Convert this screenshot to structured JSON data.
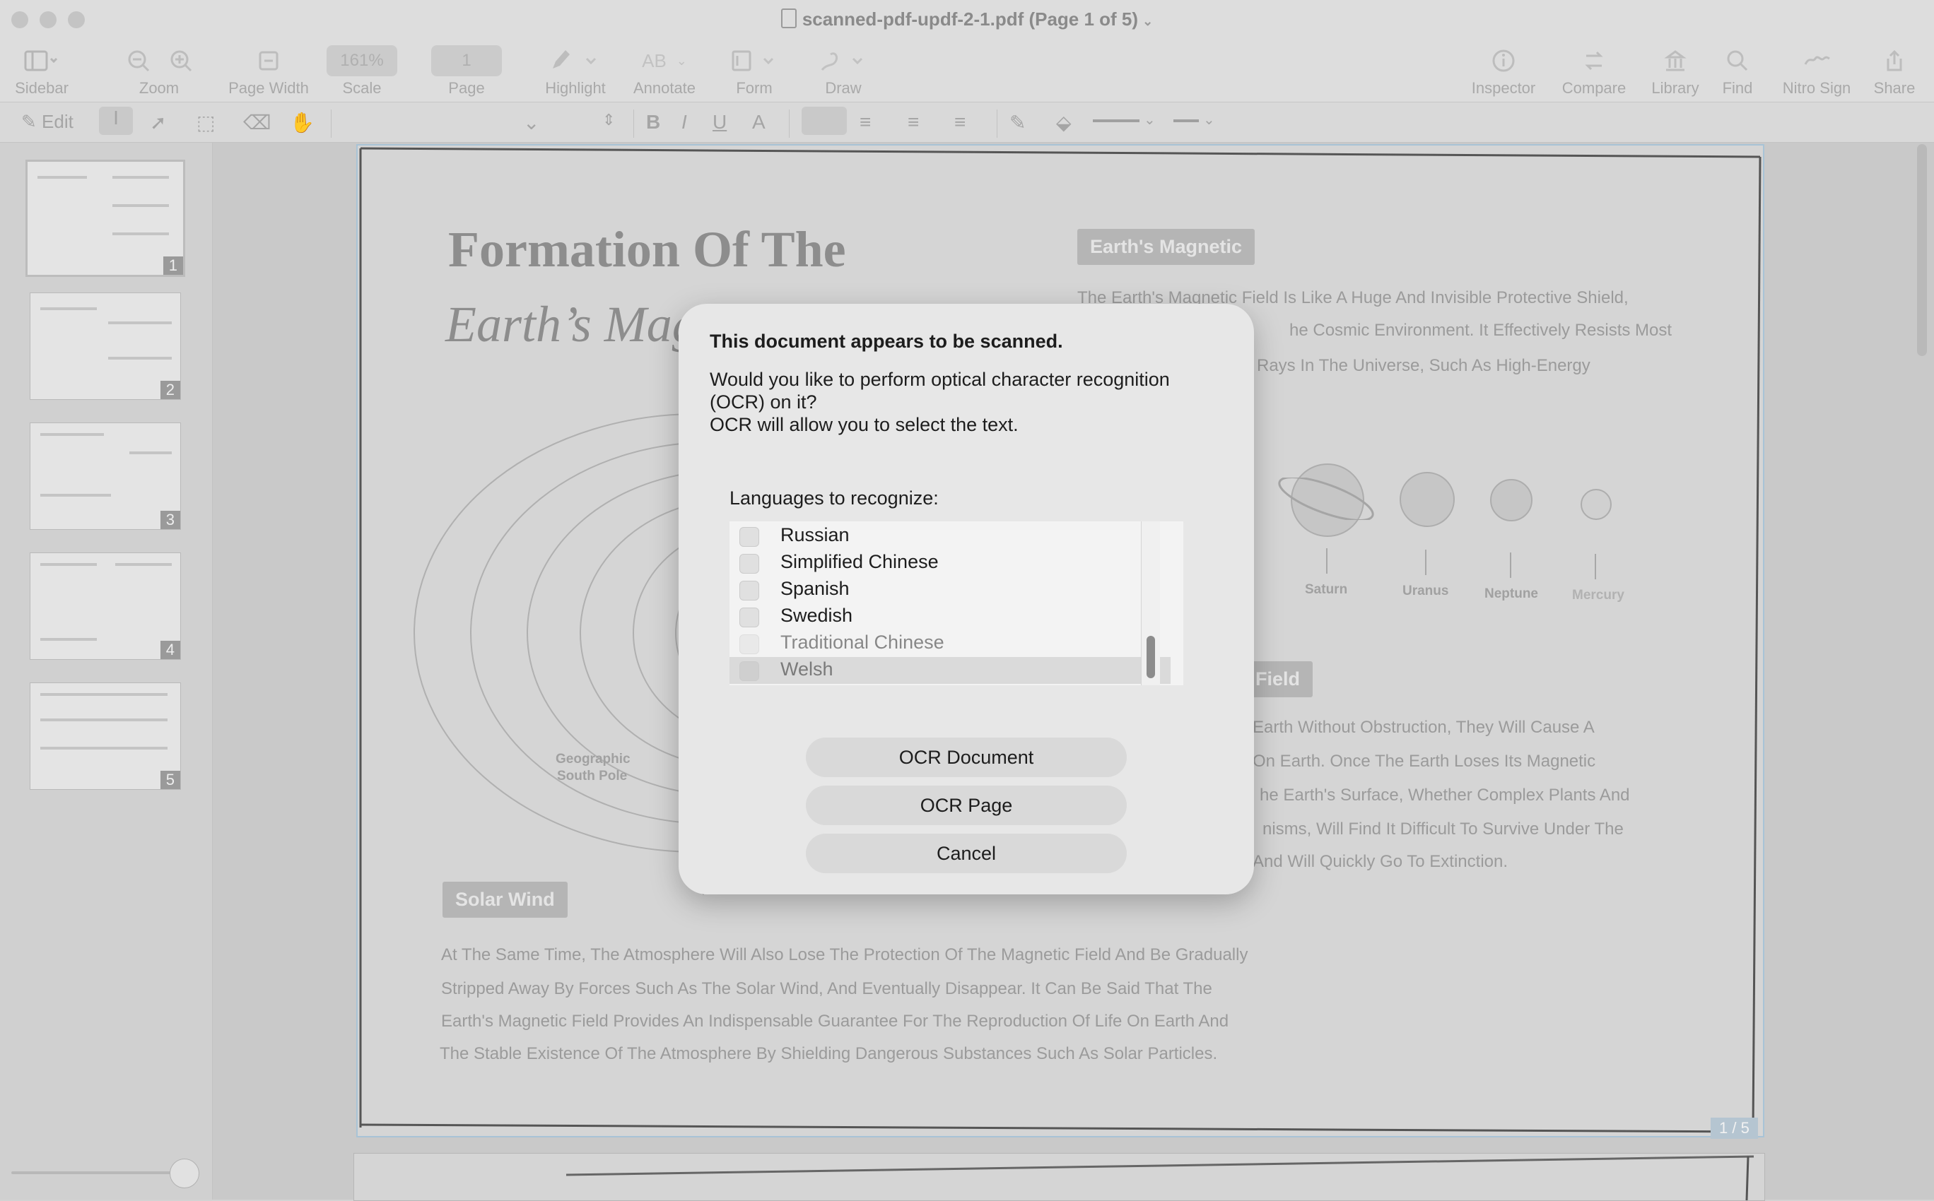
{
  "window": {
    "title": "scanned-pdf-updf-2-1.pdf (Page 1 of 5)"
  },
  "toolbar": {
    "items": [
      {
        "label": "Sidebar",
        "icon": "sidebar-icon"
      },
      {
        "label": "Zoom",
        "icon": "zoom-icon"
      },
      {
        "label": "Page Width",
        "icon": "page-width-icon"
      },
      {
        "label": "Scale",
        "value": "161%"
      },
      {
        "label": "Page",
        "value": "1"
      },
      {
        "label": "Highlight",
        "icon": "highlighter-icon"
      },
      {
        "label": "Annotate",
        "icon": "annotate-icon"
      },
      {
        "label": "Form",
        "icon": "form-icon"
      },
      {
        "label": "Draw",
        "icon": "draw-icon"
      },
      {
        "label": "Inspector",
        "icon": "info-icon"
      },
      {
        "label": "Compare",
        "icon": "compare-icon"
      },
      {
        "label": "Library",
        "icon": "library-icon"
      },
      {
        "label": "Find",
        "icon": "search-icon"
      },
      {
        "label": "Nitro Sign",
        "icon": "signature-icon"
      },
      {
        "label": "Share",
        "icon": "share-icon"
      }
    ]
  },
  "formatbar": {
    "edit_label": "Edit"
  },
  "sidebar": {
    "thumbnails": [
      "1",
      "2",
      "3",
      "4",
      "5"
    ]
  },
  "document": {
    "heading1": "Formation Of The",
    "heading2": "Earth’s Mag",
    "tag_magnetic": "Earth's Magnetic",
    "magnetic_lines": [
      "The Earth's Magnetic Field Is Like A Huge And Invisible Protective Shield,",
      "he Cosmic Environment. It Effectively Resists Most",
      "Rays In The Universe, Such As High-Energy"
    ],
    "planets": [
      "Saturn",
      "Uranus",
      "Neptune",
      "Mercury"
    ],
    "tag_field": "Field",
    "field_lines": [
      "Earth Without Obstruction, They Will Cause A",
      "On Earth. Once The Earth Loses Its Magnetic",
      "he Earth's Surface, Whether Complex Plants And",
      "nisms, Will Find It Difficult To Survive Under The",
      "And Will Quickly Go To Extinction."
    ],
    "pole_label_1": "Geographic",
    "pole_label_2": "South Pole",
    "tag_solar": "Solar Wind",
    "solar_lines": [
      "At The Same Time, The Atmosphere Will Also Lose The Protection Of The Magnetic Field And Be Gradually",
      "Stripped Away By Forces Such As The Solar Wind, And Eventually Disappear. It Can Be Said That The",
      "Earth's Magnetic Field Provides An Indispensable Guarantee For The Reproduction Of Life On Earth And",
      "The Stable Existence Of The Atmosphere By Shielding Dangerous Substances Such As Solar Particles."
    ],
    "page_badge": "1 / 5"
  },
  "dialog": {
    "title": "This document appears to be scanned.",
    "message_line1": "Would you like to perform optical character recognition",
    "message_line2": "(OCR) on it?",
    "message_line3": "OCR will allow you to select the text.",
    "languages_label": "Languages to recognize:",
    "languages": [
      {
        "name": "Russian",
        "checked": false
      },
      {
        "name": "Simplified Chinese",
        "checked": false
      },
      {
        "name": "Spanish",
        "checked": false
      },
      {
        "name": "Swedish",
        "checked": false
      },
      {
        "name": "Traditional Chinese",
        "checked": false
      },
      {
        "name": "Welsh",
        "checked": false
      }
    ],
    "buttons": {
      "ocr_document": "OCR Document",
      "ocr_page": "OCR Page",
      "cancel": "Cancel"
    }
  }
}
